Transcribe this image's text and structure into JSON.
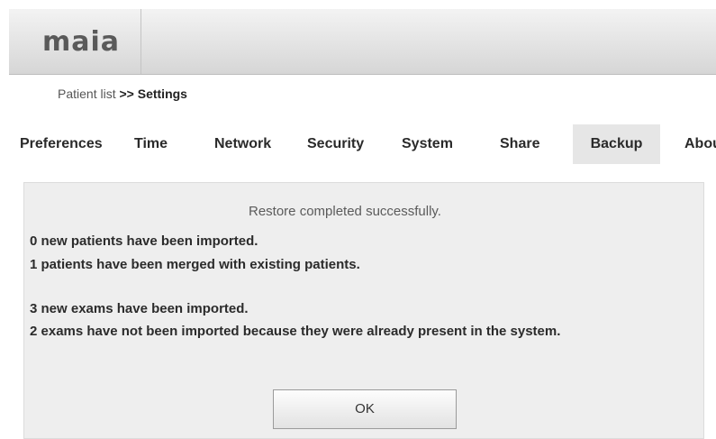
{
  "header": {
    "logo_text": "maia"
  },
  "breadcrumb": {
    "link": "Patient list",
    "separator": " >> ",
    "current": "Settings"
  },
  "tabs": [
    {
      "label": "Preferences",
      "active": false
    },
    {
      "label": "Time",
      "active": false
    },
    {
      "label": "Network",
      "active": false
    },
    {
      "label": "Security",
      "active": false
    },
    {
      "label": "System",
      "active": false
    },
    {
      "label": "Share",
      "active": false
    },
    {
      "label": "Backup",
      "active": true
    },
    {
      "label": "Abou",
      "active": false
    }
  ],
  "restore": {
    "title": "Restore completed successfully.",
    "lines": [
      "0 new patients have been imported.",
      "1 patients have been merged with existing patients.",
      "3 new exams have been imported.",
      "2 exams have not been imported because they were already present in the system."
    ],
    "ok_label": "OK"
  }
}
